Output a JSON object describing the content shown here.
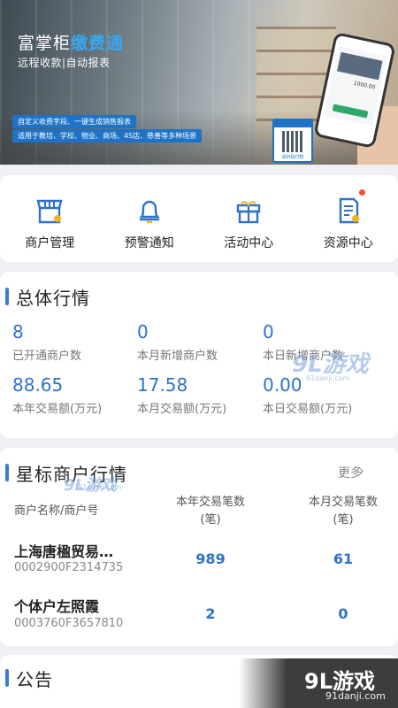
{
  "banner": {
    "title_main": "富掌柜",
    "title_highlight": "缴费通",
    "subtitle": "远程收款|自动报表",
    "desc_line1": "自定义收费字段、一键生成销售报表",
    "desc_line2": "适用于教培、学校、物业、商场、4S店、慈善等多种场景",
    "qr_caption": "请扫码付款",
    "phone_amount": "1000.00"
  },
  "quick_actions": [
    {
      "label": "商户管理",
      "icon": "shop-icon"
    },
    {
      "label": "预警通知",
      "icon": "bell-icon"
    },
    {
      "label": "活动中心",
      "icon": "gift-icon"
    },
    {
      "label": "资源中心",
      "icon": "document-icon",
      "badge": true
    }
  ],
  "overall": {
    "title": "总体行情",
    "stats": [
      {
        "value": "8",
        "label": "已开通商户数"
      },
      {
        "value": "0",
        "label": "本月新增商户数"
      },
      {
        "value": "0",
        "label": "本日新增商户数"
      },
      {
        "value": "88.65",
        "label": "本年交易额(万元)"
      },
      {
        "value": "17.58",
        "label": "本月交易额(万元)"
      },
      {
        "value": "0.00",
        "label": "本日交易额(万元)"
      }
    ]
  },
  "star_merchants": {
    "title": "星标商户行情",
    "more_label": "更多",
    "headers": {
      "name": "商户名称/商户号",
      "year_line1": "本年交易笔数",
      "year_line2": "(笔)",
      "month_line1": "本月交易笔数",
      "month_line2": "(笔)"
    },
    "rows": [
      {
        "name": "上海唐楹贸易…",
        "id": "0002900F2314735",
        "year": "989",
        "month": "61"
      },
      {
        "name": "个体户左照霞",
        "id": "0003760F3657810",
        "year": "2",
        "month": "0"
      }
    ]
  },
  "notice": {
    "title": "公告"
  },
  "watermark": {
    "brand": "9L游戏",
    "site": "91danji.com"
  },
  "colors": {
    "accent": "#2f72c9",
    "badge": "#f0523a"
  }
}
